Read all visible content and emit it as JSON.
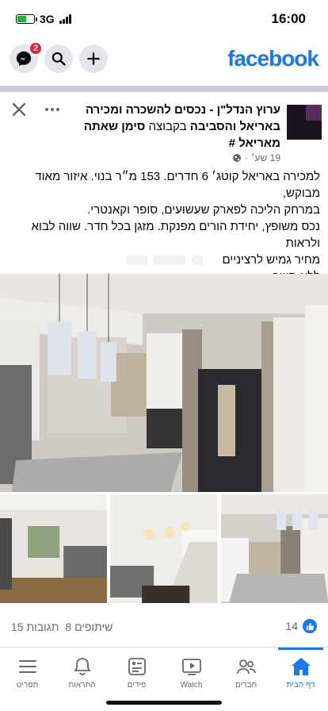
{
  "status_bar": {
    "network": "3G",
    "time": "16:00",
    "battery_fraction": 0.6
  },
  "header": {
    "logo": "facebook",
    "messenger_badge": "2"
  },
  "post": {
    "title_name": "ערוץ הנדל\"ן - נכסים להשכרה ומכירה באריאל והסביבה",
    "title_connector": "בקבוצה",
    "title_author": "סימן שאתה מאריאל #",
    "meta": "19 שע׳",
    "body": [
      "למכירה באריאל קוטג׳ 6 חדרים. 153 מ״ר בנוי. איזור מאוד מבוקש,",
      "במרחק הליכה לפארק שעשועים, סופר וקאנטרי.",
      "נכס משופץ, יחידת הורים מפנקת. מזגן בכל חדר. שווה לבוא ולראות",
      "מחיר גמיש לרציניים",
      "ללא תיווך"
    ]
  },
  "stats": {
    "likes": "14",
    "shares": "8 שיתופים",
    "comments": "15 תגובות"
  },
  "tabs": [
    {
      "label": "דף הבית",
      "icon": "home-icon",
      "active": true
    },
    {
      "label": "חברים",
      "icon": "friends-icon",
      "active": false
    },
    {
      "label": "Watch",
      "icon": "watch-icon",
      "active": false
    },
    {
      "label": "פידים",
      "icon": "feeds-icon",
      "active": false
    },
    {
      "label": "התראות",
      "icon": "bell-icon",
      "active": false
    },
    {
      "label": "תפריט",
      "icon": "menu-icon",
      "active": false
    }
  ],
  "colors": {
    "brand": "#1877f2",
    "badge": "#e41e3f"
  }
}
